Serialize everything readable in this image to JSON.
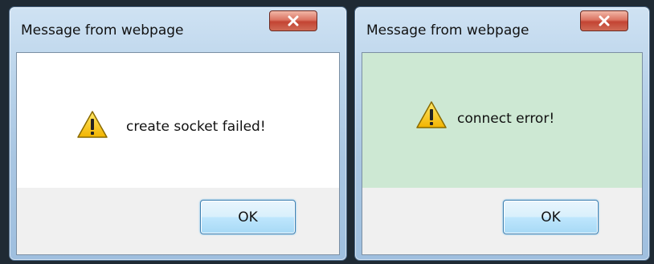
{
  "dialogs": [
    {
      "title": "Message from webpage",
      "close_label": "X",
      "message": "create socket failed!",
      "icon": "warning-icon",
      "ok_label": "OK",
      "content_background": "#ffffff"
    },
    {
      "title": "Message from webpage",
      "close_label": "X",
      "message": "connect error!",
      "icon": "warning-icon",
      "ok_label": "OK",
      "content_background": "#cde8d3"
    }
  ]
}
